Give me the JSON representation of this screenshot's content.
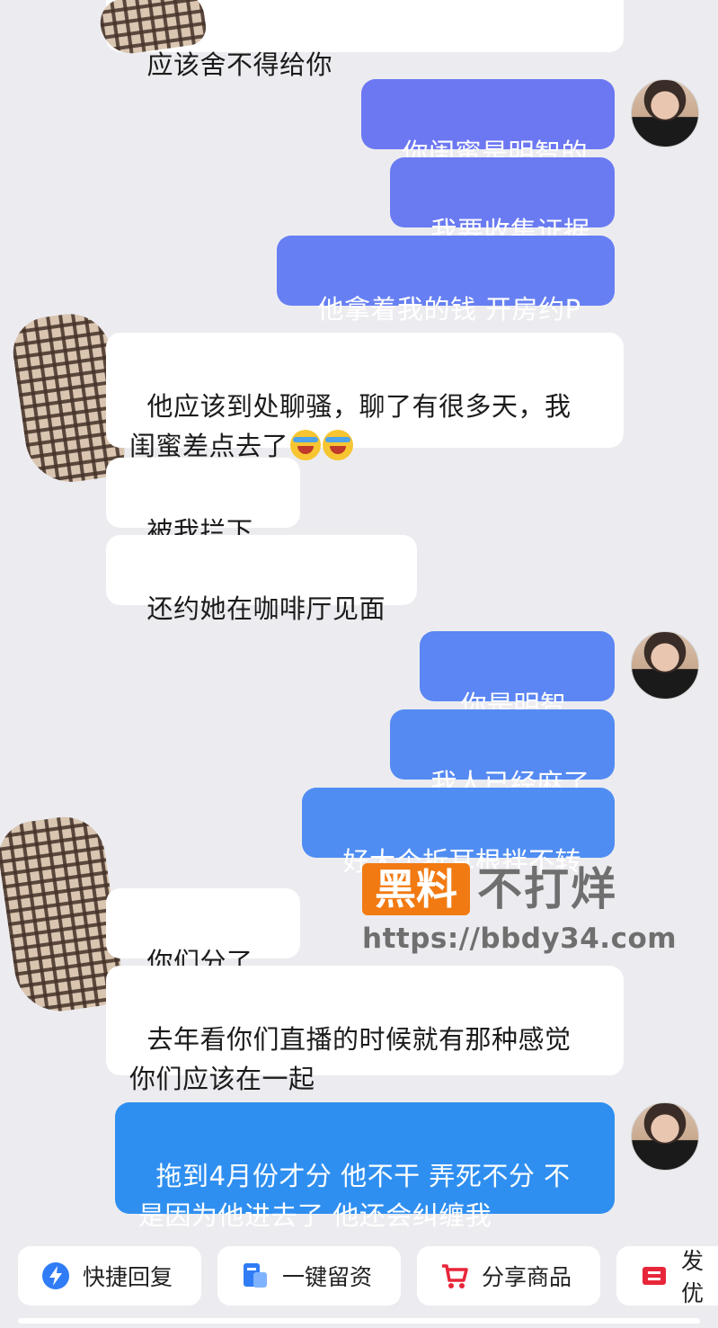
{
  "messages": [
    {
      "id": "m0",
      "side": "in",
      "text": "应该舍不得给你"
    },
    {
      "id": "m1",
      "side": "out",
      "text": "你闺蜜是明智的"
    },
    {
      "id": "m2",
      "side": "out",
      "text": "我要收集证据"
    },
    {
      "id": "m3",
      "side": "out",
      "text": "他拿着我的钱 开房约P"
    },
    {
      "id": "m4",
      "side": "in",
      "text": "他应该到处聊骚，聊了有很多天，我\n闺蜜差点去了"
    },
    {
      "id": "m5",
      "side": "in",
      "text": "被我拦下了"
    },
    {
      "id": "m6",
      "side": "in",
      "text": "还约她在咖啡厅见面"
    },
    {
      "id": "m7",
      "side": "out",
      "text": "你是明智的"
    },
    {
      "id": "m8",
      "side": "out",
      "text": "我人已经麻了"
    },
    {
      "id": "m9",
      "side": "out",
      "text": "好大个折耳根拌不转"
    },
    {
      "id": "m10",
      "side": "in",
      "text": "你们分了吗"
    },
    {
      "id": "m11",
      "side": "in",
      "text": "去年看你们直播的时候就有那种感觉\n你们应该在一起"
    },
    {
      "id": "m12",
      "side": "out",
      "text": "拖到4月份才分 他不干 弄死不分 不\n是因为他进去了 他还会纠缠我"
    }
  ],
  "colors": {
    "out_bubble_1": "#6c77f2",
    "out_bubble_2": "#5b86f3",
    "out_bubble_3": "#2f8ff0",
    "in_bubble": "#ffffff",
    "background": "#ececf0"
  },
  "emoji": "crying-laughing-emoji",
  "watermark": {
    "box_text": "黑料",
    "text": "不打烊",
    "url": "https://bbdy34.com"
  },
  "toolbar": {
    "quick_reply": "快捷回复",
    "one_click_info": "一键留资",
    "share_product": "分享商品",
    "send_coupon": "发优"
  }
}
